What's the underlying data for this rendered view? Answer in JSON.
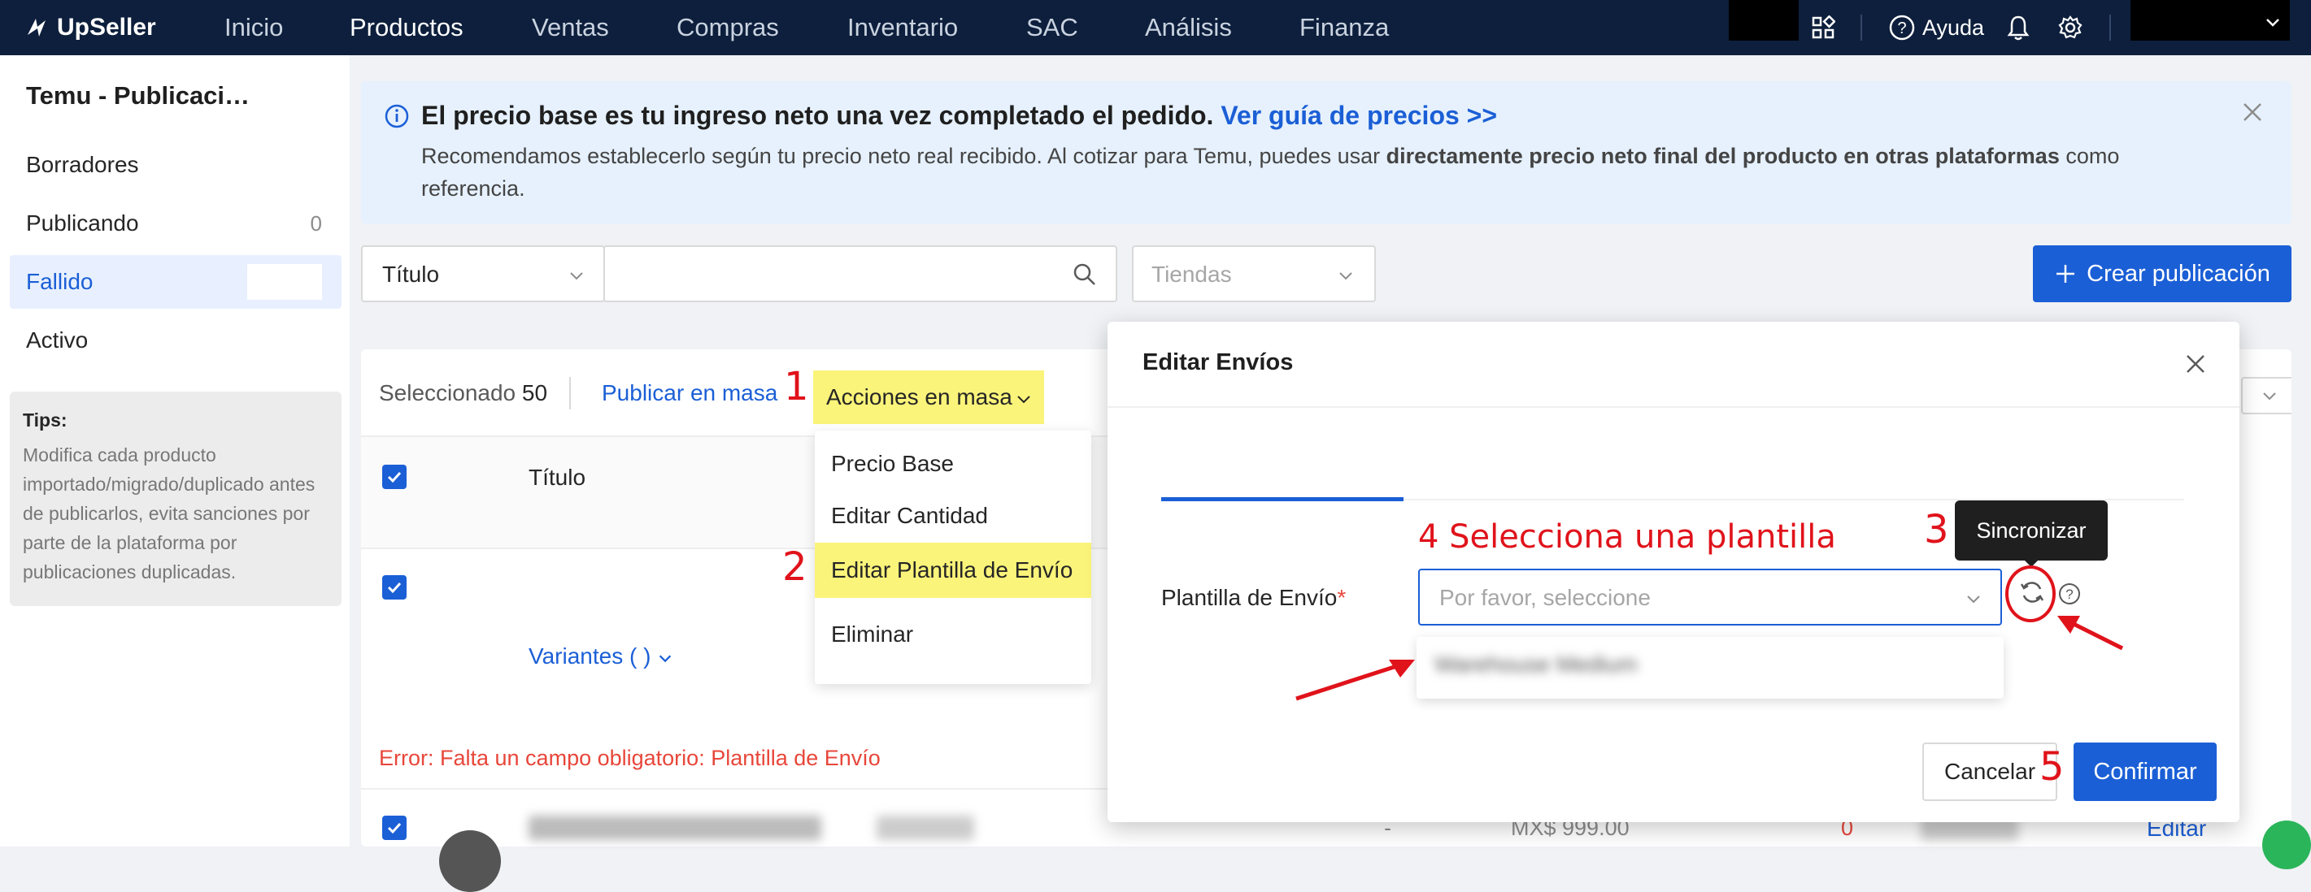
{
  "app": {
    "brand": "UpSeller"
  },
  "nav": {
    "items": [
      "Inicio",
      "Productos",
      "Ventas",
      "Compras",
      "Inventario",
      "SAC",
      "Análisis",
      "Finanza"
    ],
    "active": "Productos",
    "help_label": "Ayuda"
  },
  "sidebar": {
    "title": "Temu - Publicaci…",
    "items": [
      {
        "label": "Borradores",
        "count": ""
      },
      {
        "label": "Publicando",
        "count": "0"
      },
      {
        "label": "Fallido",
        "count": ""
      },
      {
        "label": "Activo",
        "count": ""
      }
    ],
    "active_index": 2,
    "tips_title": "Tips:",
    "tips_text": "Modifica cada producto importado/migrado/duplicado antes de publicarlos, evita sanciones por parte de la plataforma por publicaciones duplicadas."
  },
  "banner": {
    "title": "El precio base es tu ingreso neto una vez completado el pedido.",
    "link": "Ver guía de precios >>",
    "text_prefix": "Recomendamos establecerlo según tu precio neto real recibido. Al cotizar para Temu, puedes usar ",
    "text_bold": "directamente precio neto final del producto en otras plataformas",
    "text_suffix": " como referencia."
  },
  "filters": {
    "field_select": "Título",
    "search_value": "",
    "store_placeholder": "Tiendas",
    "create_button": "Crear publicación"
  },
  "table": {
    "selected_label": "Seleccionado",
    "selected_count": "50",
    "bulk_publish": "Publicar en masa",
    "bulk_actions": "Acciones en masa",
    "header_title": "Título",
    "variants_label": "Variantes (  )",
    "error_text": "Error: Falta un campo obligatorio: Plantilla de Envío",
    "row_dash": "-",
    "row_price": "MX$ 999.00",
    "row_qty": "0",
    "row_edit": "Editar"
  },
  "bulk_menu": {
    "items": [
      "Precio Base",
      "Editar Cantidad",
      "Editar Plantilla de Envío",
      "Eliminar"
    ],
    "highlighted_index": 2
  },
  "dialog": {
    "title": "Editar Envíos",
    "field_label": "Plantilla de Envío",
    "required_mark": "*",
    "select_placeholder": "Por favor, seleccione",
    "option_blurred": "Warehouse Medium",
    "tooltip": "Sincronizar",
    "cancel": "Cancelar",
    "confirm": "Confirmar"
  },
  "annotations": {
    "step1": "1",
    "step2": "2",
    "step3": "3",
    "step4": "4 Selecciona una plantilla",
    "step5": "5"
  },
  "colors": {
    "nav_bg": "#0d1f3c",
    "primary": "#1b5fd6",
    "highlight": "#fbf47a",
    "annotation": "#e0131b",
    "error": "#e8463a"
  }
}
